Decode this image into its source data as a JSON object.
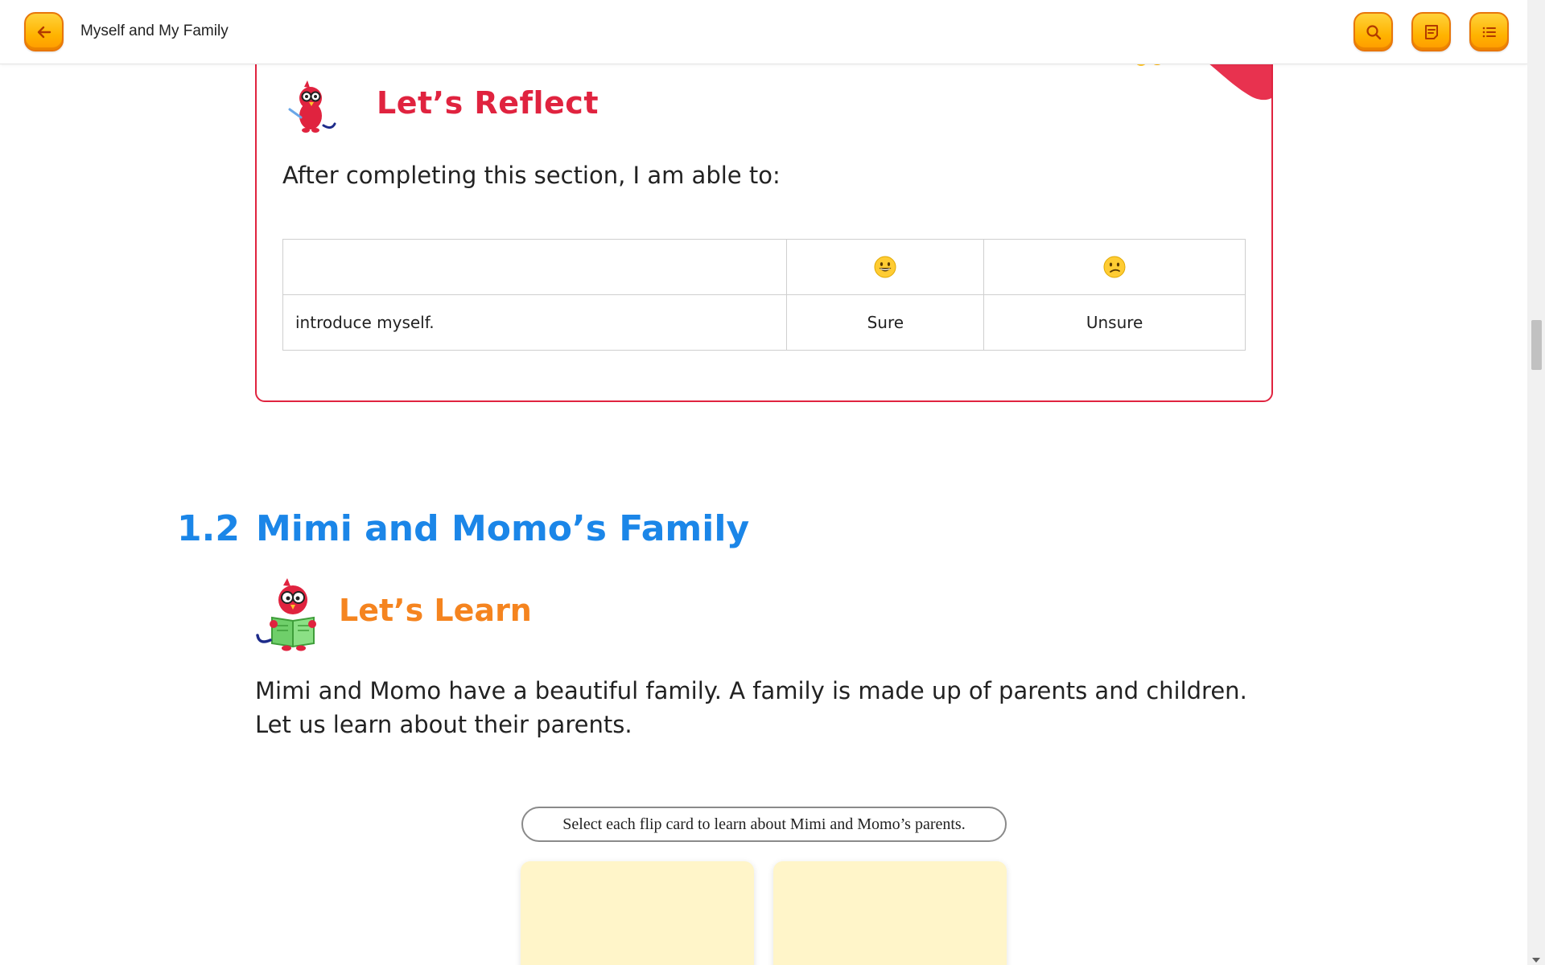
{
  "header": {
    "title": "Myself and My Family",
    "back_icon": "arrow-left-icon",
    "search_icon": "search-icon",
    "notes_icon": "notes-icon",
    "menu_icon": "list-menu-icon",
    "accent_color": "#ffb300"
  },
  "reflect": {
    "title": "Let’s Reflect",
    "intro": "After completing this section, I am able to:",
    "border_color": "#e0233f",
    "table": {
      "header_row": [
        "",
        "grinning-face-emoji",
        "confused-face-emoji"
      ],
      "rows": [
        {
          "statement": "introduce myself.",
          "option_a": "Sure",
          "option_b": "Unsure"
        }
      ]
    }
  },
  "section": {
    "number": "1.2",
    "title": "Mimi and Momo’s Family",
    "title_color": "#1b86e8"
  },
  "learn": {
    "title": "Let’s Learn",
    "title_color": "#f5841f",
    "text": "Mimi and Momo have a beautiful family. A family is made up of parents and children. Let us learn about their parents."
  },
  "flip_cards": {
    "instruction": "Select each flip card to learn about Mimi and Momo’s parents.",
    "card_color": "#fff5c9"
  }
}
